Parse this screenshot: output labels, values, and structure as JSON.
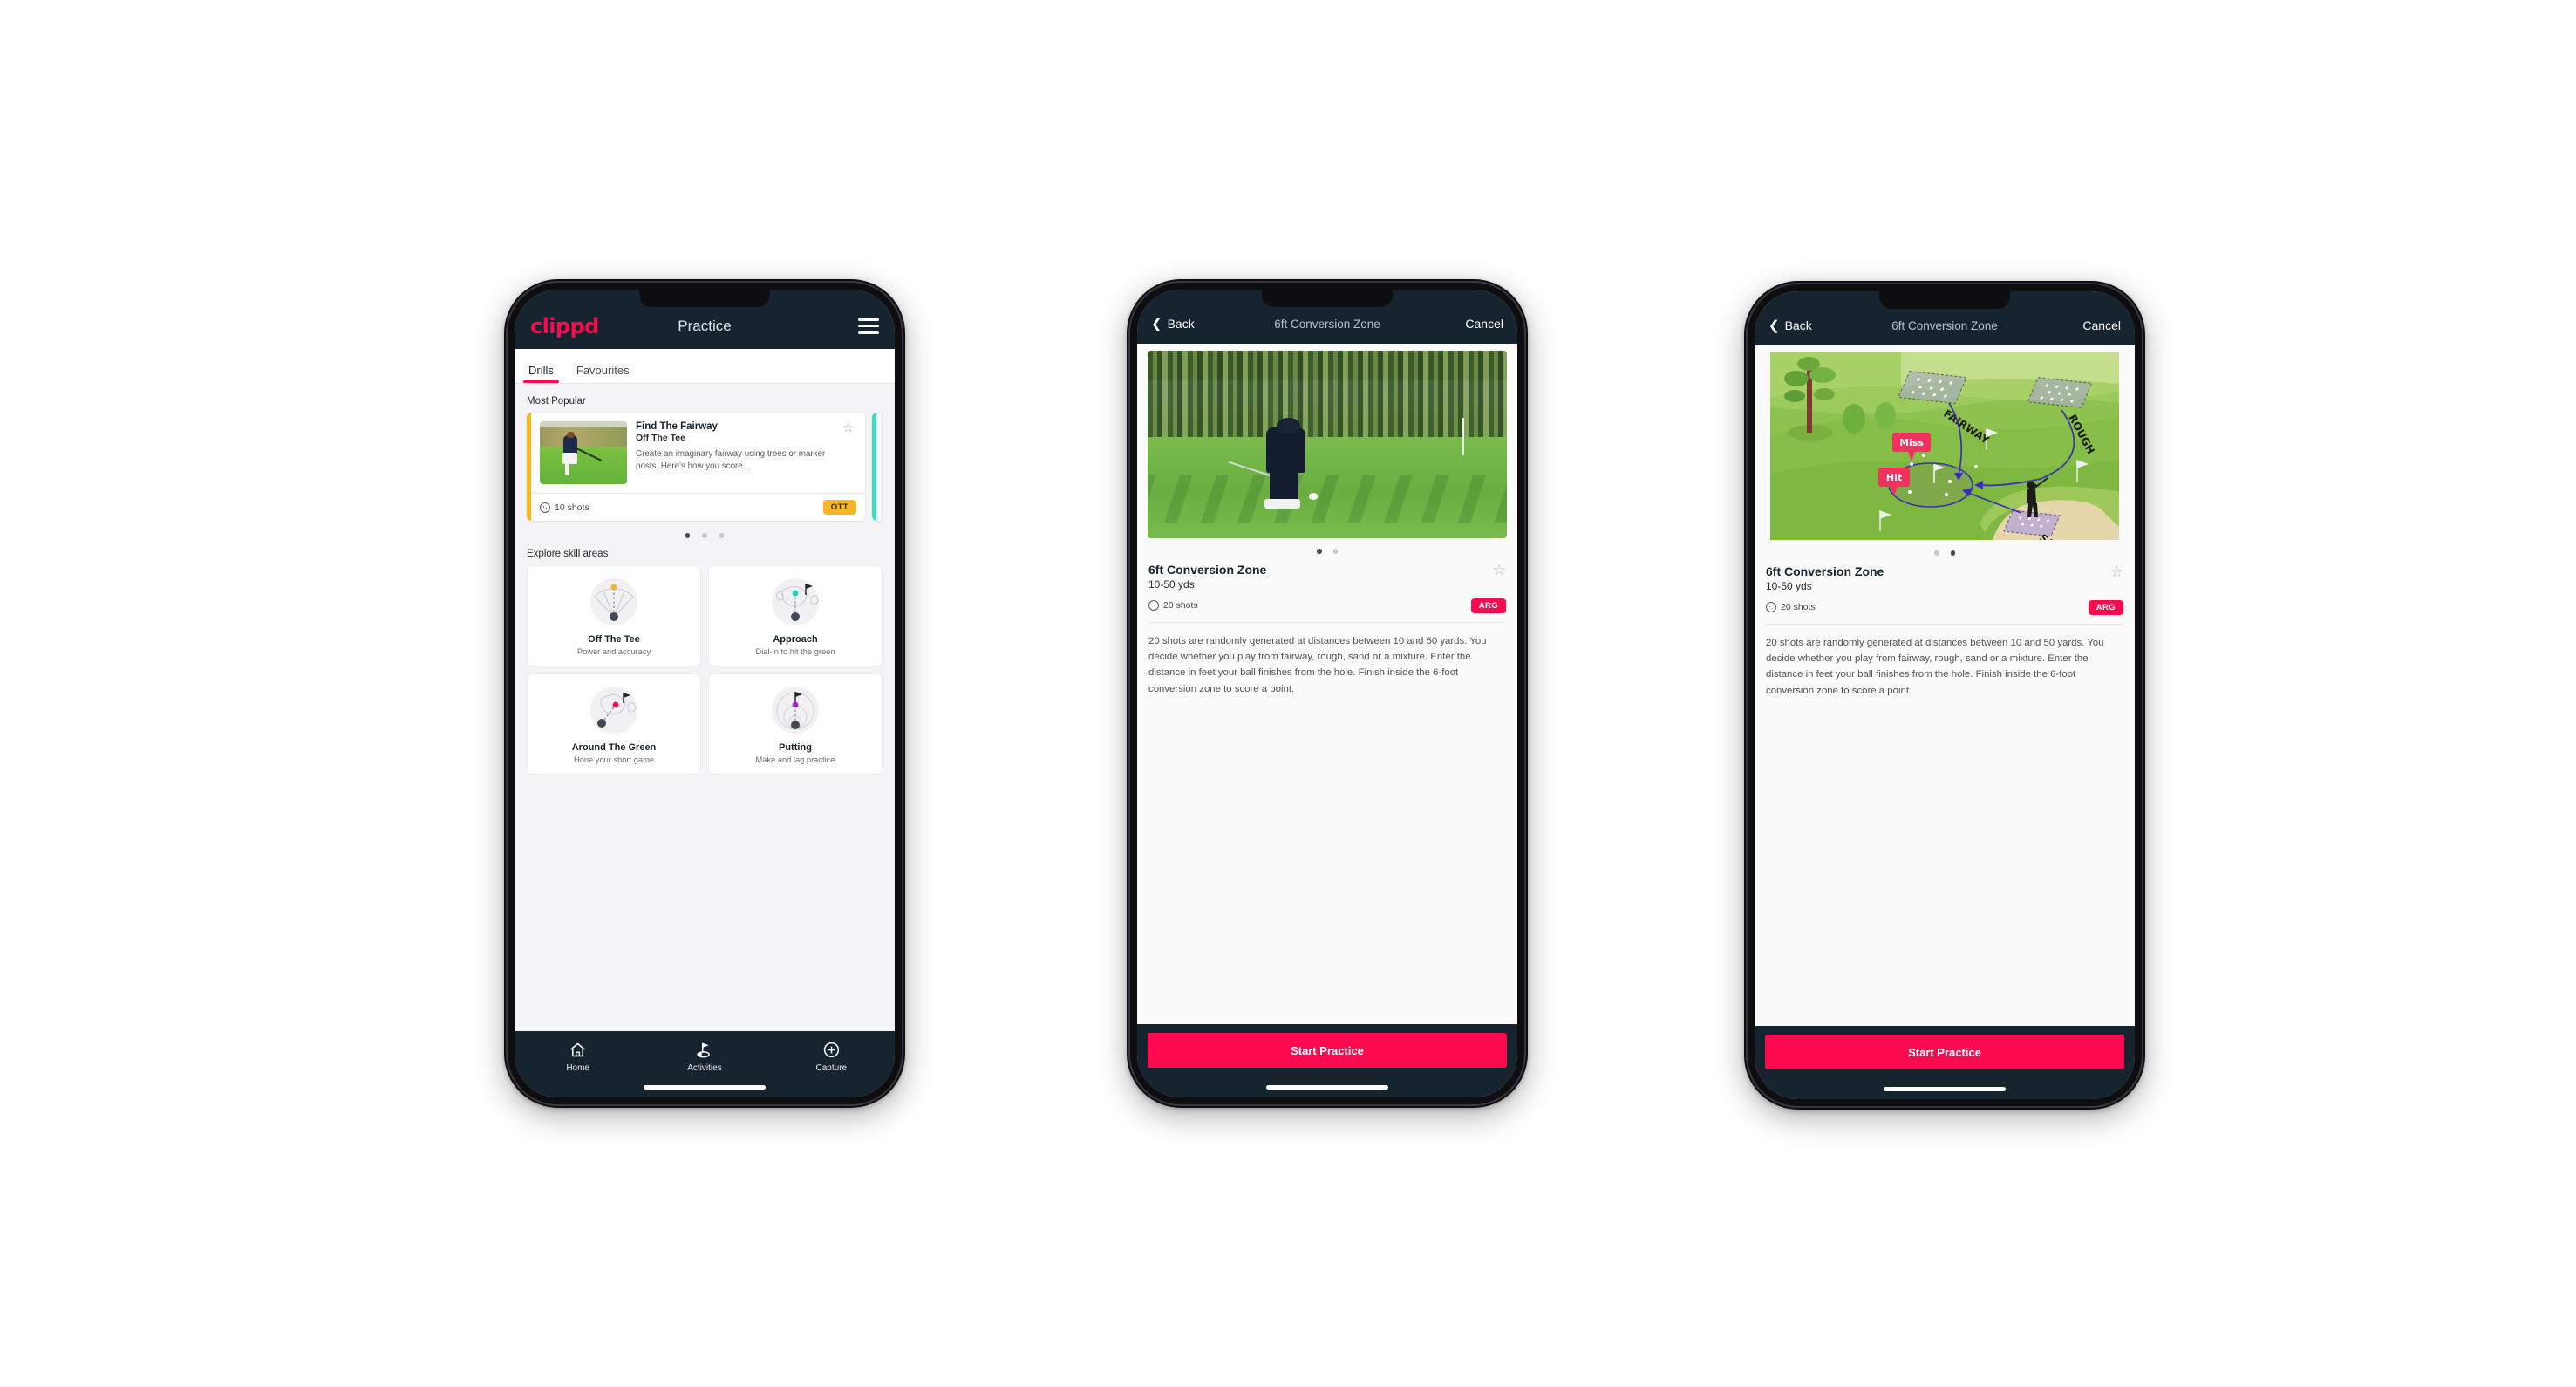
{
  "brand": {
    "name": "clippd",
    "accent": "#FB0A50",
    "navy": "#16242F",
    "amber": "#F5B623",
    "teal": "#3FD9C0"
  },
  "phone1": {
    "nav": {
      "title": "Practice",
      "menu_icon": "hamburger-menu-icon"
    },
    "tabs": [
      {
        "label": "Drills",
        "active": true
      },
      {
        "label": "Favourites",
        "active": false
      }
    ],
    "sections": {
      "most_popular": "Most Popular",
      "explore": "Explore skill areas"
    },
    "drill_card": {
      "title": "Find The Fairway",
      "subtitle": "Off The Tee",
      "description": "Create an imaginary fairway using trees or marker posts. Here's how you score...",
      "shots": "10 shots",
      "badge": "OTT",
      "accent": "#F5B623",
      "favourite_icon": "star-outline-icon"
    },
    "carousel_dots": {
      "count": 3,
      "active": 0
    },
    "skills": [
      {
        "name": "Off The Tee",
        "desc": "Power and accuracy",
        "icon": "tee-fan-icon",
        "dot": "#F5B623"
      },
      {
        "name": "Approach",
        "desc": "Dial-in to hit the green",
        "icon": "approach-green-icon",
        "dot": "#19D3B0"
      },
      {
        "name": "Around The Green",
        "desc": "Hone your short game",
        "icon": "chip-green-icon",
        "dot": "#FB0A50"
      },
      {
        "name": "Putting",
        "desc": "Make and lag practice",
        "icon": "putting-rings-icon",
        "dot": "#A020D0"
      }
    ],
    "tabbar": [
      {
        "label": "Home",
        "icon": "home-icon",
        "active": false
      },
      {
        "label": "Activities",
        "icon": "golf-flag-icon",
        "active": true
      },
      {
        "label": "Capture",
        "icon": "plus-circle-icon",
        "active": false
      }
    ]
  },
  "detail": {
    "nav": {
      "back": "Back",
      "title": "6ft Conversion Zone",
      "cancel": "Cancel",
      "back_icon": "chevron-left-icon"
    },
    "title": "6ft Conversion Zone",
    "distance": "10-50 yds",
    "shots": "20 shots",
    "badge": "ARG",
    "favourite_icon": "star-outline-icon",
    "description": "20 shots are randomly generated at distances between 10 and 50 yards. You decide whether you play from fairway, rough, sand or a mixture. Enter the distance in feet your ball finishes from the hole. Finish inside the 6-foot conversion zone to score a point.",
    "cta": "Start Practice"
  },
  "phone2": {
    "dots": {
      "count": 2,
      "active": 0
    },
    "hero": "golf-swing-photo"
  },
  "phone3": {
    "dots": {
      "count": 2,
      "active": 1
    },
    "hero": "course-diagram",
    "course_labels": {
      "fairway": "FAIRWAY",
      "rough": "ROUGH",
      "sand": "SAND",
      "miss": "Miss",
      "hit": "Hit"
    }
  }
}
